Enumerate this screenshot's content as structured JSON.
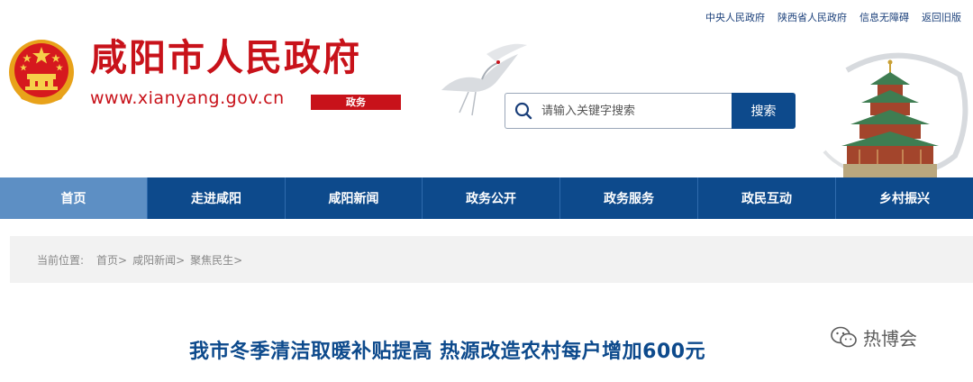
{
  "header": {
    "top_links": [
      "中央人民政府",
      "陕西省人民政府",
      "信息无障碍",
      "返回旧版"
    ],
    "site_title": "咸阳市人民政府",
    "site_url": "www.xianyang.gov.cn",
    "site_tag": "政务",
    "search": {
      "placeholder": "请输入关键字搜索",
      "button_label": "搜索"
    }
  },
  "nav": {
    "items": [
      "首页",
      "走进咸阳",
      "咸阳新闻",
      "政务公开",
      "政务服务",
      "政民互动",
      "乡村振兴"
    ],
    "active_index": 0
  },
  "breadcrumb": {
    "label": "当前位置:",
    "items": [
      "首页>",
      "咸阳新闻>",
      "聚焦民生>"
    ]
  },
  "article": {
    "title": "我市冬季清洁取暖补贴提高 热源改造农村每户增加600元"
  },
  "watermark": {
    "text": "热博会"
  },
  "colors": {
    "brand_red": "#c8121a",
    "nav_blue": "#0d4a8c",
    "nav_active": "#5d8fc4",
    "breadcrumb_bg": "#f2f2f2"
  },
  "icons": [
    "national-emblem-icon",
    "crane-decoration-icon",
    "search-icon",
    "pavilion-image",
    "wechat-icon"
  ]
}
